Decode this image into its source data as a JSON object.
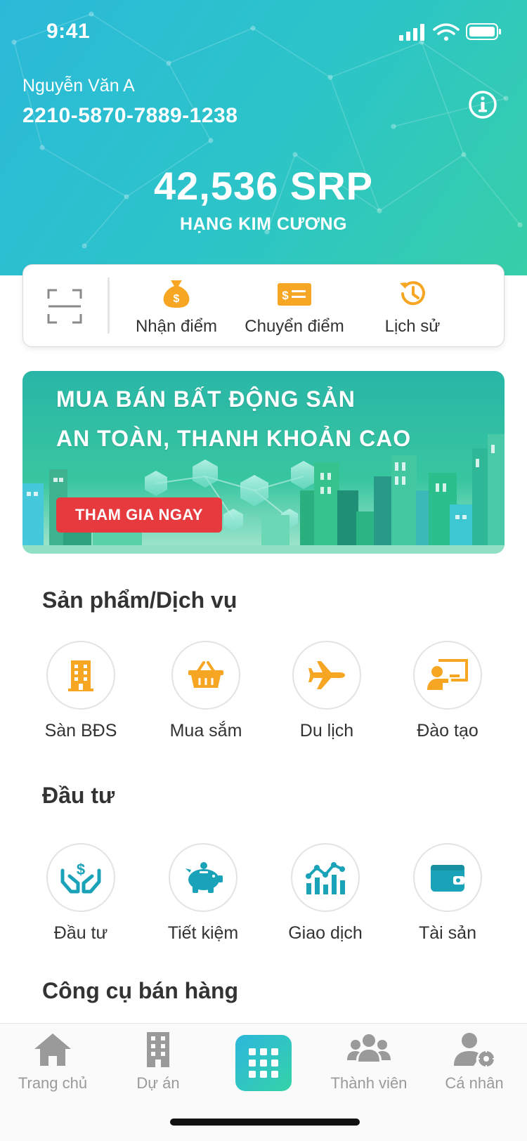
{
  "status_bar": {
    "time": "9:41"
  },
  "header": {
    "user_name": "Nguyễn Văn A",
    "card_number": "2210-5870-7889-1238",
    "points": "42,536 SRP",
    "rank": "HẠNG KIM CƯƠNG"
  },
  "actions": {
    "receive_label": "Nhận điểm",
    "transfer_label": "Chuyển điểm",
    "history_label": "Lịch sử"
  },
  "banner": {
    "line1": "MUA BÁN BẤT ĐỘNG SẢN",
    "line2": "AN TOÀN, THANH KHOẢN CAO",
    "cta": "THAM GIA NGAY"
  },
  "products": {
    "title": "Sản phẩm/Dịch vụ",
    "items": [
      {
        "label": "Sàn BĐS",
        "icon": "building-icon"
      },
      {
        "label": "Mua sắm",
        "icon": "shopping-basket-icon"
      },
      {
        "label": "Du lịch",
        "icon": "airplane-icon"
      },
      {
        "label": "Đào tạo",
        "icon": "teacher-board-icon"
      }
    ]
  },
  "invest": {
    "title": "Đầu tư",
    "items": [
      {
        "label": "Đầu tư",
        "icon": "hands-dollar-icon"
      },
      {
        "label": "Tiết kiệm",
        "icon": "piggy-bank-icon"
      },
      {
        "label": "Giao dịch",
        "icon": "chart-icon"
      },
      {
        "label": "Tài sản",
        "icon": "wallet-icon"
      }
    ]
  },
  "sales_tools": {
    "title": "Công cụ bán hàng"
  },
  "tabbar": {
    "items": [
      {
        "label": "Trang chủ",
        "icon": "home-icon"
      },
      {
        "label": "Dự án",
        "icon": "building-icon"
      },
      {
        "label": "",
        "icon": "grid-icon"
      },
      {
        "label": "Thành viên",
        "icon": "members-icon"
      },
      {
        "label": "Cá nhân",
        "icon": "user-settings-icon"
      }
    ]
  },
  "colors": {
    "accent_orange": "#f6a623",
    "accent_teal": "#1aa3b8",
    "cta_red": "#e63a3f",
    "header_gradient_start": "#2bb9d9",
    "header_gradient_end": "#36cfa8",
    "tab_inactive": "#9a9a9a"
  }
}
